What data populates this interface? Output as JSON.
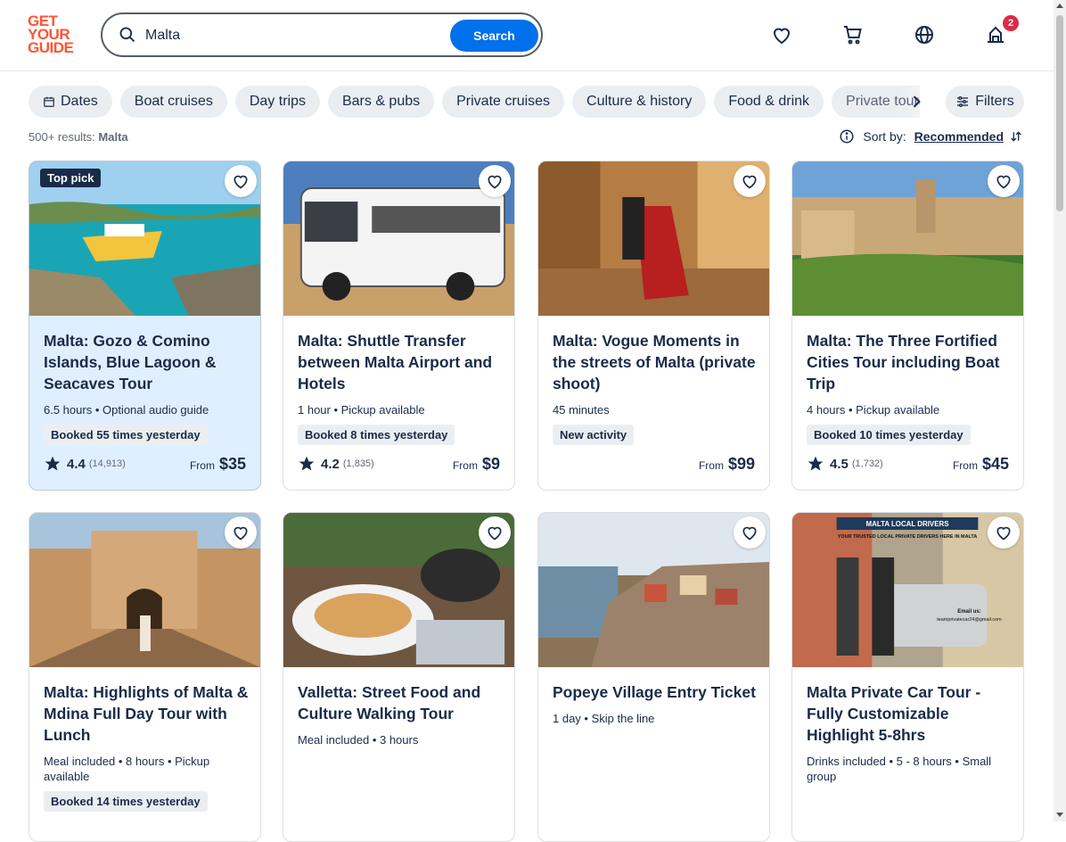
{
  "header": {
    "logo_lines": [
      "GET",
      "YOUR",
      "GUIDE"
    ],
    "search_value": "Malta",
    "search_button": "Search",
    "cart_badge": "2"
  },
  "filters": {
    "chips": [
      "Dates",
      "Boat cruises",
      "Day trips",
      "Bars & pubs",
      "Private cruises",
      "Culture & history",
      "Food & drink",
      "Private tours"
    ],
    "filters_label": "Filters"
  },
  "results": {
    "count": "500+ results:",
    "query": "Malta",
    "sort_label": "Sort by:",
    "sort_value": "Recommended"
  },
  "cards": [
    {
      "title": "Malta: Gozo & Comino Islands, Blue Lagoon & Seacaves Tour",
      "meta": "6.5 hours • Optional audio guide",
      "tag": "Booked 55 times yesterday",
      "rating": "4.4",
      "reviews": "(14,913)",
      "from": "From",
      "price": "$35",
      "badge": "Top pick"
    },
    {
      "title": "Malta: Shuttle Transfer between Malta Airport and Hotels",
      "meta": "1 hour • Pickup available",
      "tag": "Booked 8 times yesterday",
      "rating": "4.2",
      "reviews": "(1,835)",
      "from": "From",
      "price": "$9"
    },
    {
      "title": "Malta: Vogue Moments in the streets of Malta (private shoot)",
      "meta": "45 minutes",
      "tag": "New activity",
      "from": "From",
      "price": "$99"
    },
    {
      "title": "Malta: The Three Fortified Cities Tour including Boat Trip",
      "meta": "4 hours • Pickup available",
      "tag": "Booked 10 times yesterday",
      "rating": "4.5",
      "reviews": "(1,732)",
      "from": "From",
      "price": "$45"
    },
    {
      "title": "Malta: Highlights of Malta & Mdina Full Day Tour with Lunch",
      "meta": "Meal included • 8 hours • Pickup available",
      "tag": "Booked 14 times yesterday"
    },
    {
      "title": "Valletta: Street Food and Culture Walking Tour",
      "meta": "Meal included • 3 hours"
    },
    {
      "title": "Popeye Village Entry Ticket",
      "meta": "1 day • Skip the line"
    },
    {
      "title": "Malta Private Car Tour - Fully Customizable Highlight 5-8hrs",
      "meta": "Drinks included • 5 - 8 hours • Small group",
      "img_text_1": "MALTA LOCAL DRIVERS",
      "img_text_2": "YOUR TRUSTED LOCAL PRIVATE DRIVERS HERE IN MALTA",
      "img_text_3": "Email us:",
      "img_text_4": "teamprivatecar24@gmail.com"
    }
  ],
  "colors": {
    "brand": "#ff5533",
    "primary": "#0071eb",
    "text": "#1a2b49",
    "highlight_card": "#e0efff"
  }
}
